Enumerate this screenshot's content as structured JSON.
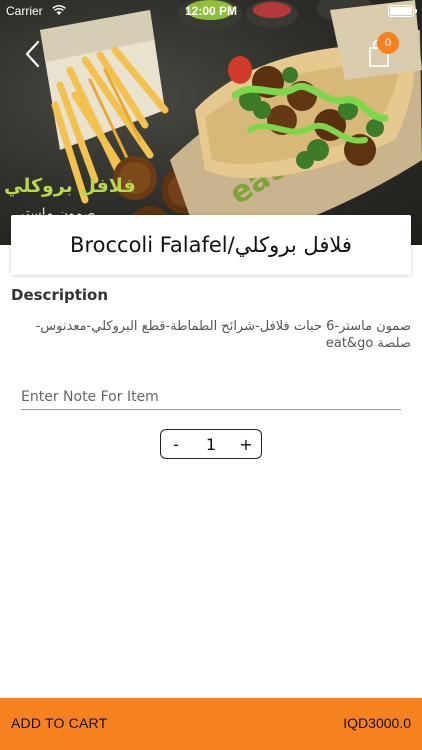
{
  "status_bar": {
    "carrier": "Carrier",
    "time": "12:00 PM"
  },
  "header": {
    "cart_count": "0"
  },
  "hero": {
    "alt": "Broccoli falafel sandwich with fries",
    "overlay_text_line1": "فلافل بروكلي",
    "overlay_text_line2": "صمون ماستر",
    "wrapper_brand": "eat&go"
  },
  "product": {
    "title": "Broccoli Falafel/فلافل بروكلي",
    "description_heading": "Description",
    "description": "صمون ماستر-6 حبات فلافل-شرائح الطماطة-قطع البروكلي-معدنوس-صلصة eat&go"
  },
  "note": {
    "placeholder": "Enter Note For Item",
    "value": ""
  },
  "quantity": {
    "minus": "-",
    "value": "1",
    "plus": "+"
  },
  "footer": {
    "add_to_cart": "ADD TO CART",
    "price": "IQD3000.0"
  },
  "colors": {
    "accent": "#f5821f",
    "sauce_green": "#7cd84a"
  }
}
